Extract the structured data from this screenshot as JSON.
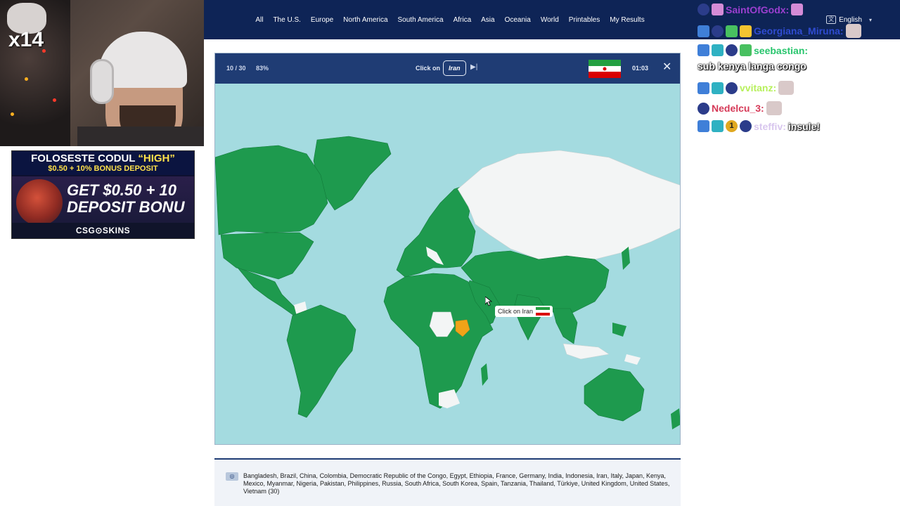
{
  "nav": {
    "links": [
      "All",
      "The U.S.",
      "Europe",
      "North America",
      "South America",
      "Africa",
      "Asia",
      "Oceania",
      "World",
      "Printables",
      "My Results"
    ],
    "language": "English"
  },
  "webcam": {
    "overlay_text": "x14"
  },
  "ad": {
    "line1_prefix": "FOLOSESTE CODUL",
    "line1_code": "“HIGH”",
    "line2": "$0.50 + 10% BONUS DEPOSIT",
    "big_line1": "GET $0.50 + 10",
    "big_line2": "DEPOSIT BONU",
    "footer": "CSG⊙SKINS"
  },
  "game": {
    "progress": "10 / 30",
    "score_percent": "83%",
    "prompt_prefix": "Click on",
    "target_country": "Iran",
    "timer": "01:03",
    "tooltip": "Click on Iran"
  },
  "answers": {
    "text": "Bangladesh, Brazil, China, Colombia, Democratic Republic of the Congo, Egypt, Ethiopia, France, Germany, India, Indonesia, Iran, Italy, Japan, Kenya, Mexico, Myanmar, Nigeria, Pakistan, Philippines, Russia, South Africa, South Korea, Spain, Tanzania, Thailand, Türkiye, United Kingdom, United States, Vietnam (30)"
  },
  "chat": {
    "messages": [
      {
        "user": "SaintOfGodx:",
        "text": ""
      },
      {
        "user": "Georgiana_Miruna:",
        "text": ""
      },
      {
        "user": "seebastian:",
        "text": "sub kenya langa congo"
      },
      {
        "user": "vvitanz:",
        "text": ""
      },
      {
        "user": "Nedelcu_3:",
        "text": ""
      },
      {
        "user": "steffiv:",
        "text": "insule!"
      }
    ],
    "gold_badge_number": "1"
  },
  "colors": {
    "nav_bg": "#0e2456",
    "card_head": "#1f3c74",
    "ocean": "#a4dbe0",
    "correct_country": "#1e9a4e",
    "unanswered_country": "#f3f5f5",
    "highlight_country": "#f0a318"
  }
}
